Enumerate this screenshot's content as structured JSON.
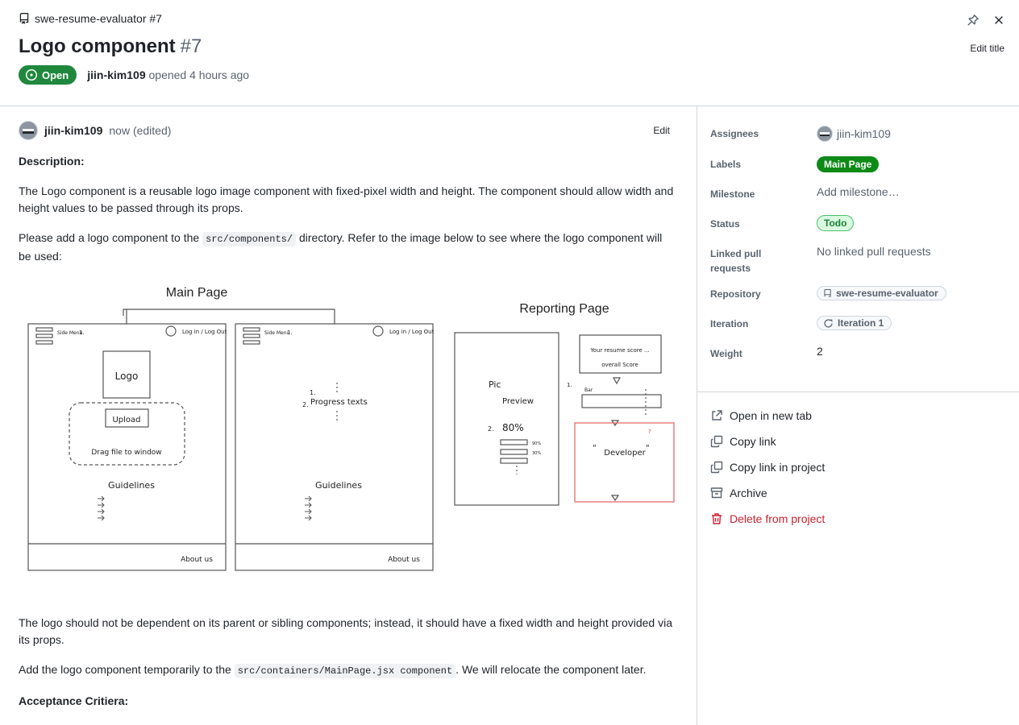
{
  "header": {
    "repo": "swe-resume-evaluator #7",
    "title": "Logo component",
    "number": "#7",
    "state": "Open",
    "author": "jiin-kim109",
    "opened_text": "opened 4 hours ago",
    "edit_title": "Edit title",
    "icons": [
      "repo-icon",
      "pin-icon",
      "close-icon",
      "issue-open-icon"
    ]
  },
  "comment": {
    "author": "jiin-kim109",
    "time": "now (edited)",
    "edit": "Edit",
    "description_heading": "Description:",
    "p1": "The Logo component is a reusable logo image component with fixed-pixel width and height. The component should allow width and height values to be passed through its props.",
    "p2_before": "Please add a logo component to the ",
    "p2_code": "src/components/",
    "p2_after": " directory. Refer to the image below to see where the logo component will be used:",
    "p3": "The logo should not be dependent on its parent or sibling components; instead, it should have a fixed width and height provided via its props.",
    "p4_before": "Add the logo component temporarily to the ",
    "p4_code": "src/containers/MainPage.jsx component",
    "p4_after": ". We will relocate the component later.",
    "acceptance_heading": "Acceptance Critiera:"
  },
  "sketch": {
    "main_page_title": "Main Page",
    "reporting_page_title": "Reporting Page",
    "side_menu": "Side Menu",
    "one": "1.",
    "two": "2.",
    "login": "Log in / Log Out",
    "logo": "Logo",
    "upload": "Upload",
    "drag": "Drag file to window",
    "guidelines": "Guidelines",
    "about": "About us",
    "progress": "Progress texts",
    "pic": "Pic",
    "preview": "Preview",
    "pct": "80%",
    "pct_small_1": "90%",
    "pct_small_2": "30%",
    "score_1": "Your resume score ...",
    "score_2": "overall Score",
    "bar": "Bar",
    "developer": "Developer",
    "quote_open": "\"",
    "quote_close": "\"",
    "question": "?",
    "arrow": "→"
  },
  "sidebar": {
    "assignees_label": "Assignees",
    "assignee": "jiin-kim109",
    "labels_label": "Labels",
    "label": "Main Page",
    "milestone_label": "Milestone",
    "milestone": "Add milestone…",
    "status_label": "Status",
    "status": "Todo",
    "linked_label": "Linked pull requests",
    "linked": "No linked pull requests",
    "repository_label": "Repository",
    "repository": "swe-resume-evaluator",
    "iteration_label": "Iteration",
    "iteration": "Iteration 1",
    "weight_label": "Weight",
    "weight": "2"
  },
  "actions": {
    "open_new_tab": "Open in new tab",
    "copy_link": "Copy link",
    "copy_link_project": "Copy link in project",
    "archive": "Archive",
    "delete": "Delete from project"
  },
  "colors": {
    "open_green": "#1f883d",
    "label_green": "#0e8a16",
    "danger": "#cf222e",
    "muted": "#59636e",
    "border": "#d0d7de"
  }
}
